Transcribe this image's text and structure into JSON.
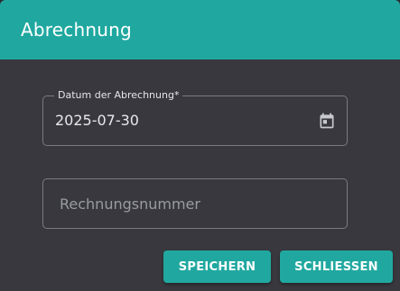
{
  "dialog": {
    "title": "Abrechnung"
  },
  "fields": {
    "date": {
      "label": "Datum der Abrechnung*",
      "value": "2025-07-30",
      "icon": "calendar-icon"
    },
    "invoice_number": {
      "value": "",
      "placeholder": "Rechnungsnummer"
    }
  },
  "actions": {
    "save_label": "SPEICHERN",
    "close_label": "SCHLIESSEN"
  },
  "colors": {
    "accent": "#20a8a0",
    "surface": "#38383e",
    "text": "#e8e8ec"
  }
}
